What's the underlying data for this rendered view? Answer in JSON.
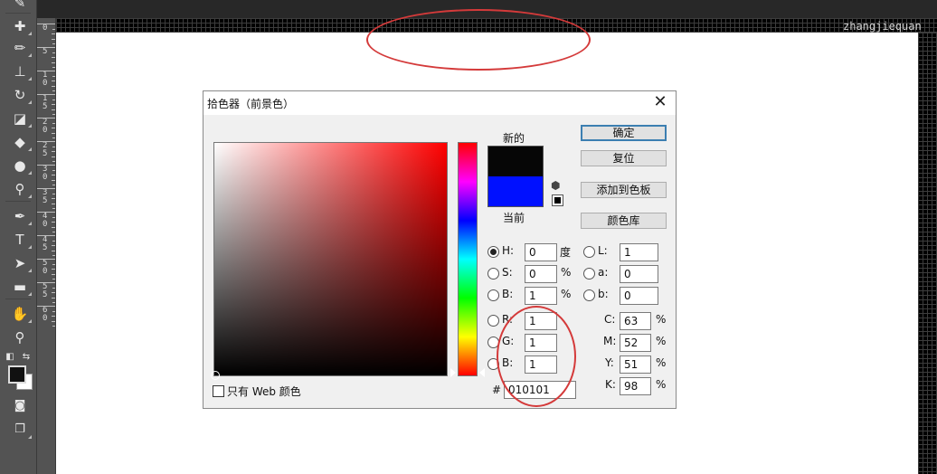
{
  "watermark": "zhangjiequan",
  "ruler": {
    "labels": [
      [
        "0"
      ],
      [
        "5"
      ],
      [
        "1",
        "0"
      ],
      [
        "1",
        "5"
      ],
      [
        "2",
        "0"
      ],
      [
        "2",
        "5"
      ],
      [
        "3",
        "0"
      ],
      [
        "3",
        "5"
      ],
      [
        "4",
        "0"
      ],
      [
        "4",
        "5"
      ],
      [
        "5",
        "0"
      ],
      [
        "5",
        "5"
      ],
      [
        "6",
        "0"
      ]
    ]
  },
  "dialog": {
    "title": "拾色器（前景色）",
    "close": "✕",
    "new_label": "新的",
    "current_label": "当前",
    "new_color": "#060606",
    "current_color": "#0010ff",
    "buttons": {
      "ok": "确定",
      "reset": "复位",
      "add_swatch": "添加到色板",
      "libraries": "颜色库"
    },
    "web_only": "只有 Web 颜色",
    "hsb": [
      {
        "key": "H:",
        "value": "0",
        "unit": "度",
        "selected": true
      },
      {
        "key": "S:",
        "value": "0",
        "unit": "%",
        "selected": false
      },
      {
        "key": "B:",
        "value": "1",
        "unit": "%",
        "selected": false
      }
    ],
    "lab": [
      {
        "key": "L:",
        "value": "1"
      },
      {
        "key": "a:",
        "value": "0"
      },
      {
        "key": "b:",
        "value": "0"
      }
    ],
    "rgb": [
      {
        "key": "R:",
        "value": "1"
      },
      {
        "key": "G:",
        "value": "1"
      },
      {
        "key": "B:",
        "value": "1"
      }
    ],
    "cmyk": [
      {
        "key": "C:",
        "value": "63",
        "unit": "%"
      },
      {
        "key": "M:",
        "value": "52",
        "unit": "%"
      },
      {
        "key": "Y:",
        "value": "51",
        "unit": "%"
      },
      {
        "key": "K:",
        "value": "98",
        "unit": "%"
      }
    ],
    "hex_label": "#",
    "hex_value": "010101"
  },
  "annotation_color": "#d43a3a",
  "toolbar_icons": [
    "brush-icon",
    "spot-healing-icon",
    "brush-tool-icon",
    "clone-stamp-icon",
    "history-brush-icon",
    "eraser-icon",
    "paint-bucket-icon",
    "blur-icon",
    "dodge-icon",
    "pen-icon",
    "type-icon",
    "path-selection-icon",
    "rectangle-icon",
    "hand-icon",
    "zoom-icon"
  ]
}
